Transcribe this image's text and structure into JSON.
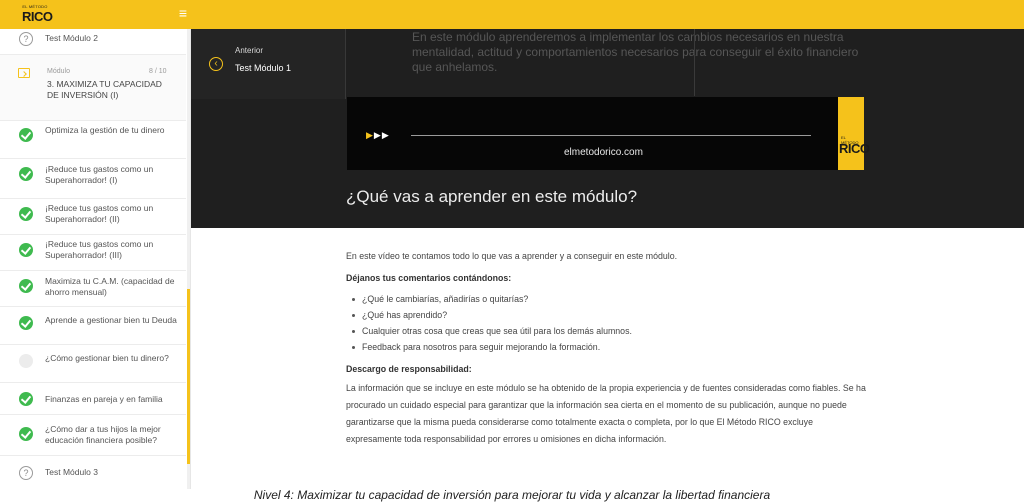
{
  "header": {
    "logo_line1": "EL MÉTODO",
    "logo_line2": "RICO",
    "menu_icon": "hamburger-icon",
    "brand_color": "#f5c21b"
  },
  "sidebar": {
    "items": [
      {
        "label": "Test Módulo 2",
        "state": "test"
      },
      {
        "tag": "Módulo",
        "count": "8 / 10",
        "label": "3. MAXIMIZA TU CAPACIDAD DE INVERSIÓN (I)",
        "state": "module"
      },
      {
        "label": "Optimiza la gestión de tu dinero",
        "state": "done"
      },
      {
        "label": "¡Reduce tus gastos como un Superahorrador! (I)",
        "state": "done"
      },
      {
        "label": "¡Reduce tus gastos como un Superahorrador! (II)",
        "state": "done"
      },
      {
        "label": "¡Reduce tus gastos como un Superahorrador! (III)",
        "state": "done"
      },
      {
        "label": "Maximiza tu C.A.M. (capacidad de ahorro mensual)",
        "state": "done"
      },
      {
        "label": "Aprende a gestionar bien tu Deuda",
        "state": "done"
      },
      {
        "label": "¿Cómo gestionar bien tu dinero?",
        "state": "todo"
      },
      {
        "label": "Finanzas en pareja y en familia",
        "state": "done"
      },
      {
        "label": "¿Cómo dar a tus hijos la mejor educación financiera posible?",
        "state": "done"
      },
      {
        "label": "Test Módulo 3",
        "state": "test"
      }
    ]
  },
  "player": {
    "prev_label": "Anterior",
    "prev_title": "Test Módulo 1",
    "overlay_text": "En este módulo aprenderemos a implementar los cambios necesarios en nuestra mentalidad, actitud y comportamientos necesarios para conseguir el éxito financiero que anhelamos.",
    "domain": "elmetodorico.com",
    "badge_line1": "EL MÉTODO",
    "badge_line2": "RICO"
  },
  "main": {
    "section_title": "¿Qué vas a aprender en este módulo?",
    "intro": "En este vídeo te contamos todo lo que vas a aprender y a conseguir en este módulo.",
    "comments_heading": "Déjanos tus comentarios contándonos:",
    "bullets": [
      "¿Qué le cambiarías, añadirías o quitarías?",
      "¿Qué has aprendido?",
      "Cualquier otras cosa que creas que sea útil para los demás alumnos.",
      "Feedback para nosotros para seguir mejorando la formación."
    ],
    "disclaimer_heading": "Descargo de responsabilidad:",
    "disclaimer_body": "La información que se incluye en este módulo se ha obtenido de la propia experiencia y de fuentes consideradas como fiables. Se ha procurado un cuidado especial para garantizar que la información sea cierta en el momento de su publicación, aunque no puede garantizarse que la misma pueda considerarse como totalmente exacta o completa, por lo que El Método RICO excluye expresamente toda responsabilidad por errores u omisiones en dicha información."
  },
  "footer_caption": "Nivel 4: Maximizar tu capacidad de inversión para mejorar tu vida y alcanzar la libertad financiera"
}
